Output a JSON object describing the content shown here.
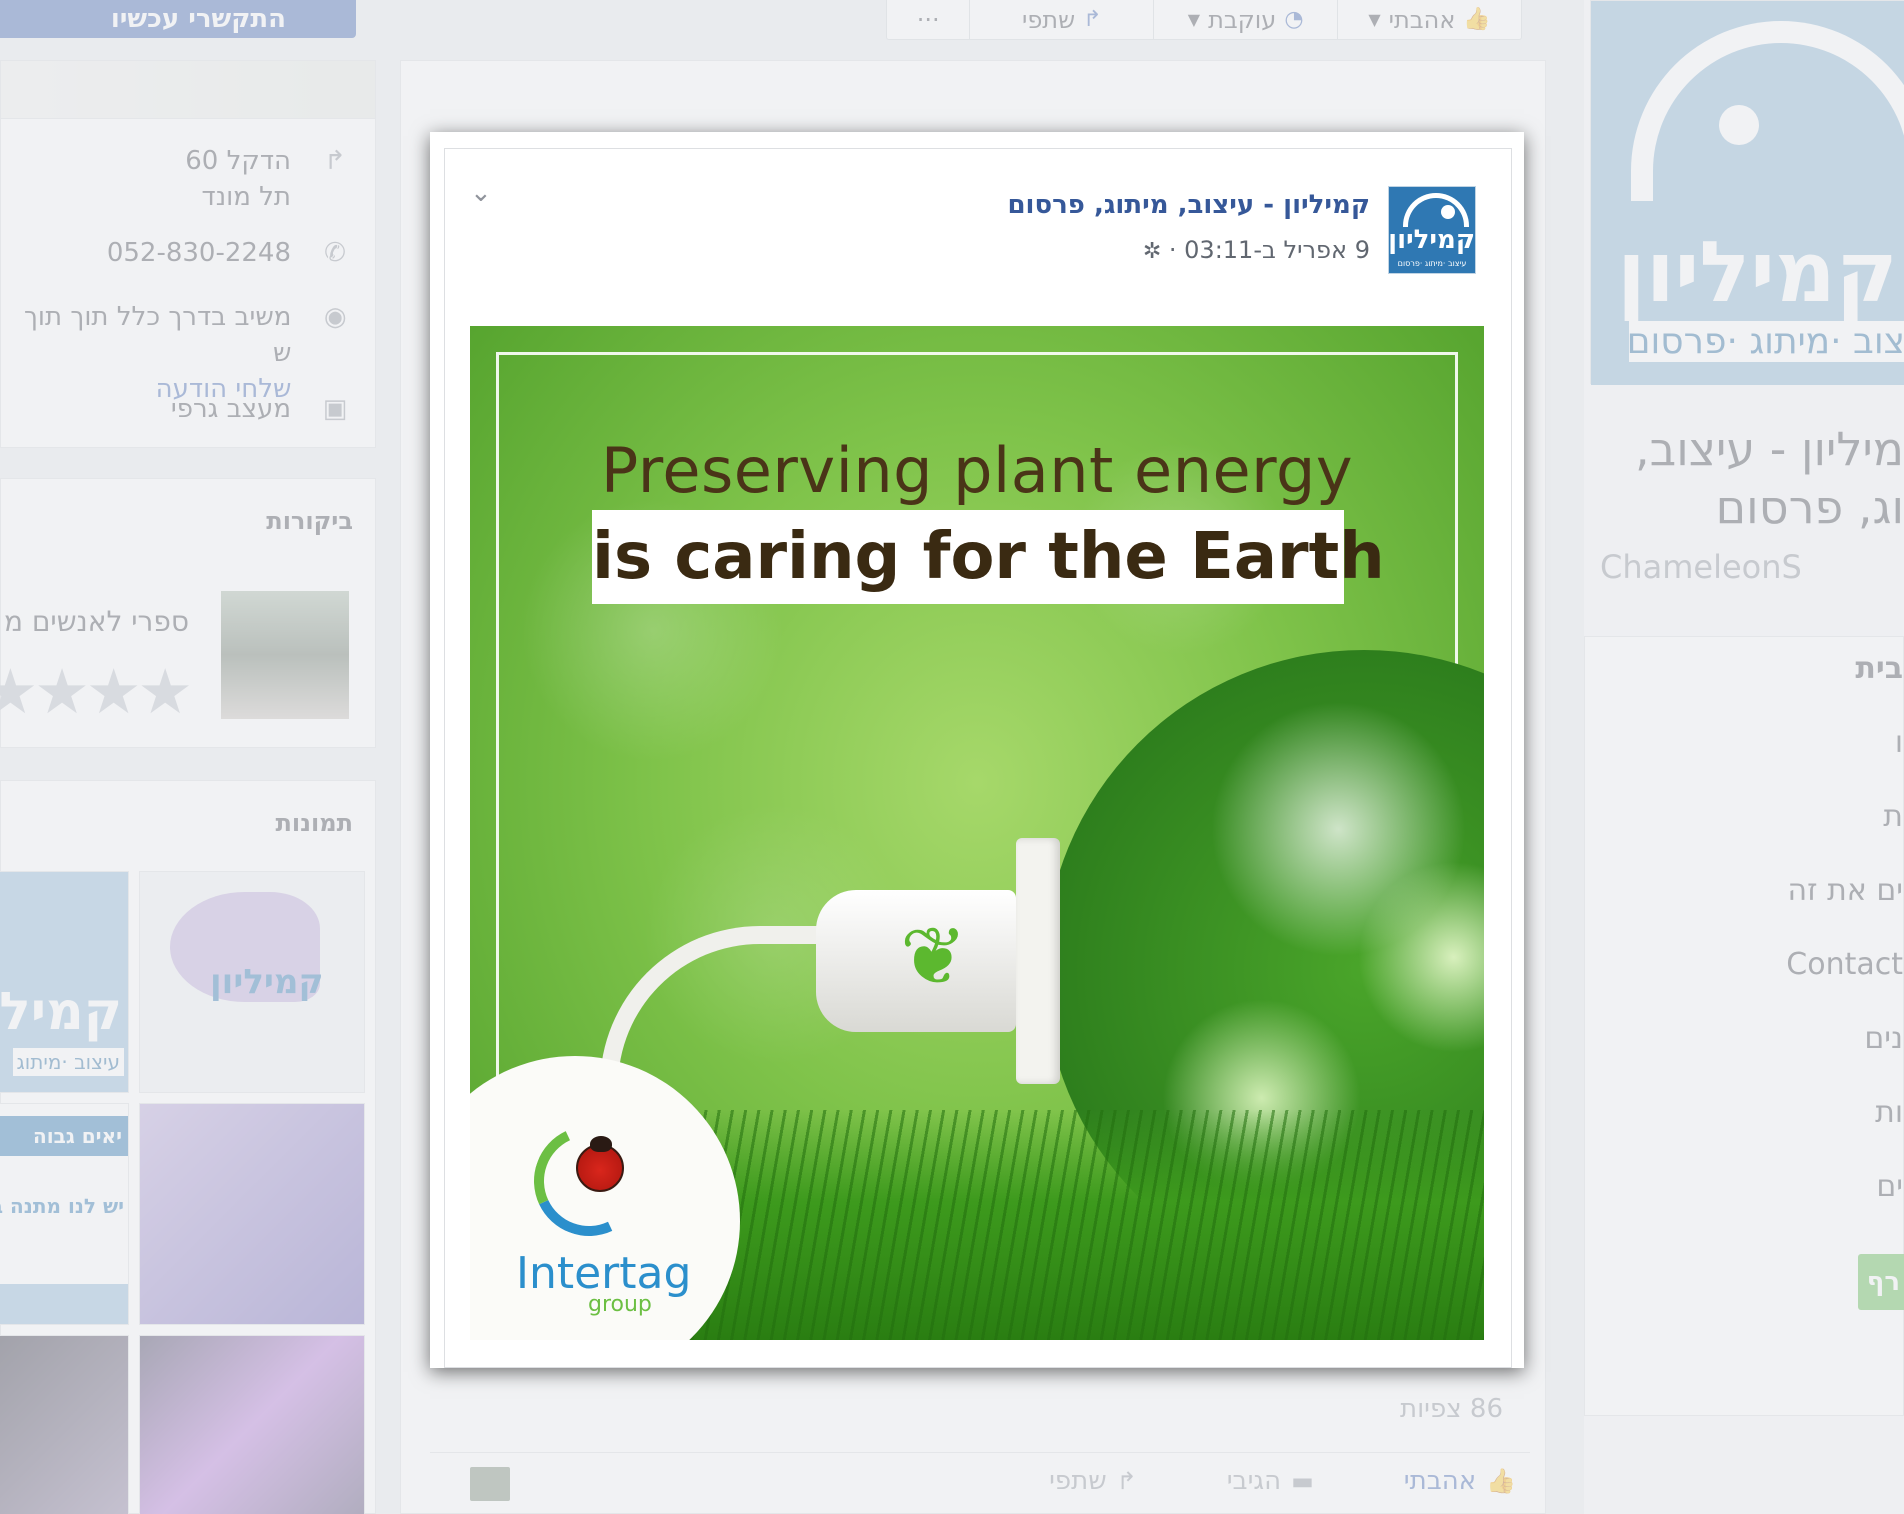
{
  "background": {
    "contact_button": "התקשרי עכשיו",
    "top_actions": {
      "like": "אהבתי",
      "follow": "עוקבת",
      "share": "שתפי",
      "more": "···"
    },
    "about": {
      "address_line1": "הדקל 60",
      "address_line2": "תל מונד",
      "phone": "052-830-2248",
      "response": "משיב בדרך כלל תוך תוך ש",
      "send_message": "שלחי הודעה",
      "category": "מעצב גרפי"
    },
    "reviews": {
      "title": "ביקורות",
      "prompt": "ספרי לאנשים מ",
      "stars": "★★★★"
    },
    "photos": {
      "title": "תמונות",
      "thumb_logo": "קמיליון",
      "thumb_tagline": "עיצוב ·מיתוג",
      "thumb_promo_title": "יאים גבוה",
      "thumb_promo_body": "יש לנו מתנה ב"
    },
    "views": "86 צפיות",
    "bottom_actions": {
      "like": "אהבתי",
      "comment": "הגיבי",
      "share": "שתפי"
    },
    "right_column": {
      "logo_text": "קמיליון",
      "logo_tagline": "צוב ·מיתוג ·פרסום",
      "page_name_line1": "מיליון - עיצוב,",
      "page_name_line2": "וג, פרסום",
      "handle": "ChameleonS",
      "nav": [
        "בית",
        "ו",
        "ת",
        "ים את זה",
        "Contact",
        "נים",
        "ות",
        "ים"
      ],
      "green_button": "רף"
    }
  },
  "post": {
    "page_name": "קמיליון - עיצוב, מיתוג, פרסום",
    "date": "9 אפריל ב-03:11 ·",
    "avatar_text": "קמיליון",
    "avatar_sub": "עיצוב ·מיתוג ·פרסום",
    "image": {
      "headline_line1": "Preserving plant energy",
      "headline_line2": "is caring for the Earth",
      "logo_name": "Intertag",
      "logo_sub": "group"
    }
  },
  "colors": {
    "facebook_blue": "#4267b2",
    "link_blue": "#365899",
    "green": "#5fb94e",
    "logo_blue": "#8ab4d3"
  },
  "icons": [
    "thumbs-up-icon",
    "rss-icon",
    "share-icon",
    "directions-icon",
    "phone-icon",
    "messenger-icon",
    "category-icon",
    "gear-icon",
    "chevron-down-icon",
    "comment-icon"
  ]
}
